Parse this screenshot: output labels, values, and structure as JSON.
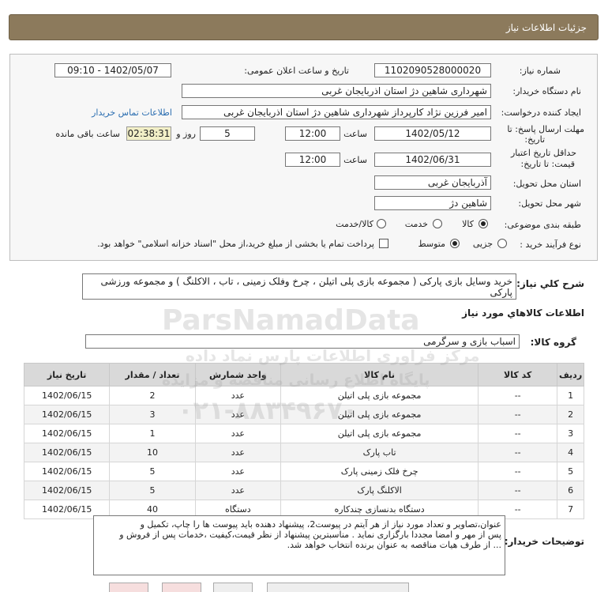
{
  "header": {
    "title": "جزئیات اطلاعات نیاز"
  },
  "form": {
    "need_number": {
      "label": "شماره نیاز:",
      "value": "1102090528000020"
    },
    "announce_datetime": {
      "label": "تاریخ و ساعت اعلان عمومی:",
      "value": "1402/05/07 - 09:10"
    },
    "buyer_org": {
      "label": "نام دستگاه خریدار:",
      "value": "شهرداری شاهین دژ استان اذربایجان غربی"
    },
    "requester": {
      "label": "ایجاد کننده درخواست:",
      "value": "امیر فرزین نژاد کارپرداز شهرداری شاهین دژ استان اذربایجان غربی",
      "contact_link": "اطلاعات تماس خریدار"
    },
    "deadline": {
      "label_line1": "مهلت ارسال پاسخ: تا",
      "label_line2": "تاریخ:",
      "date": "1402/05/12",
      "time_label": "ساعت",
      "time": "12:00",
      "days": "5",
      "days_label": "روز و",
      "remaining": "02:38:31",
      "remaining_label": "ساعت باقی مانده"
    },
    "validity": {
      "label_line1": "حداقل تاریخ اعتبار",
      "label_line2": "قیمت: تا تاریخ:",
      "date": "1402/06/31",
      "time_label": "ساعت",
      "time": "12:00"
    },
    "delivery_province": {
      "label": "استان محل تحویل:",
      "value": "آذربایجان غربی"
    },
    "delivery_city": {
      "label": "شهر محل تحویل:",
      "value": "شاهین دژ"
    },
    "category": {
      "label": "طبقه بندی موضوعی:",
      "options": [
        "کالا",
        "خدمت",
        "کالا/خدمت"
      ],
      "selected": "کالا"
    },
    "process_type": {
      "label": "نوع فرآیند خرید :",
      "options": [
        "جزیی",
        "متوسط"
      ],
      "selected": "متوسط",
      "treasury_note": "پرداخت تمام یا بخشی از مبلغ خرید،از محل \"اسناد خزانه اسلامی\" خواهد بود."
    }
  },
  "general_desc": {
    "label": "شرح کلي نياز:",
    "value": "خرید وسایل بازی پارکی ( مجموعه بازی پلی اتیلن ، چرخ وفلک زمینی ، تاب ، الاکلنگ ) و مجموعه ورزشی پارکی"
  },
  "goods_section": {
    "title": "اطلاعات کالاهاي مورد نياز",
    "group_label": "گروه کالا:",
    "group_value": "اسباب بازی و سرگرمی"
  },
  "table": {
    "headers": [
      "ردیف",
      "کد کالا",
      "نام کالا",
      "واحد شمارش",
      "تعداد / مقدار",
      "تاریخ نیاز"
    ],
    "rows": [
      [
        "1",
        "--",
        "مجموعه بازی پلی اتیلن",
        "عدد",
        "2",
        "1402/06/15"
      ],
      [
        "2",
        "--",
        "مجموعه بازی پلی اتیلن",
        "عدد",
        "3",
        "1402/06/15"
      ],
      [
        "3",
        "--",
        "مجموعه بازی پلی اتیلن",
        "عدد",
        "1",
        "1402/06/15"
      ],
      [
        "4",
        "--",
        "تاب پارک",
        "عدد",
        "10",
        "1402/06/15"
      ],
      [
        "5",
        "--",
        "چرخ فلک زمینی پارک",
        "عدد",
        "5",
        "1402/06/15"
      ],
      [
        "6",
        "--",
        "الاکلنگ پارک",
        "عدد",
        "5",
        "1402/06/15"
      ],
      [
        "7",
        "--",
        "دستگاه بدنسازی چندکاره",
        "دستگاه",
        "40",
        "1402/06/15"
      ]
    ]
  },
  "buyer_notes": {
    "label": "توضیحات خریدار:",
    "lines": [
      "عنوان،تصاویر و تعداد مورد نیاز از هر آیتم در پیوست2، پیشنهاد دهنده باید پیوست ها را چاپ، تکمیل و",
      "پس از مهر و امضا مجددا بارگزاری نماید . مناسبترین پیشنهاد از نظر قیمت،کیفیت ،خدمات پس از فروش و",
      "... از طرف هیات مناقصه به عنوان برنده انتخاب خواهد شد."
    ]
  },
  "watermark": {
    "brand": "ParsNamadData",
    "line1": "مرکز فراوری اطلاعات پارس نماد داده",
    "line2": "پایگاه اطلاع رسانی مناقصه و مزایده",
    "phone": "۰۲۱-۸۸۳۴۹۶۷۰"
  }
}
